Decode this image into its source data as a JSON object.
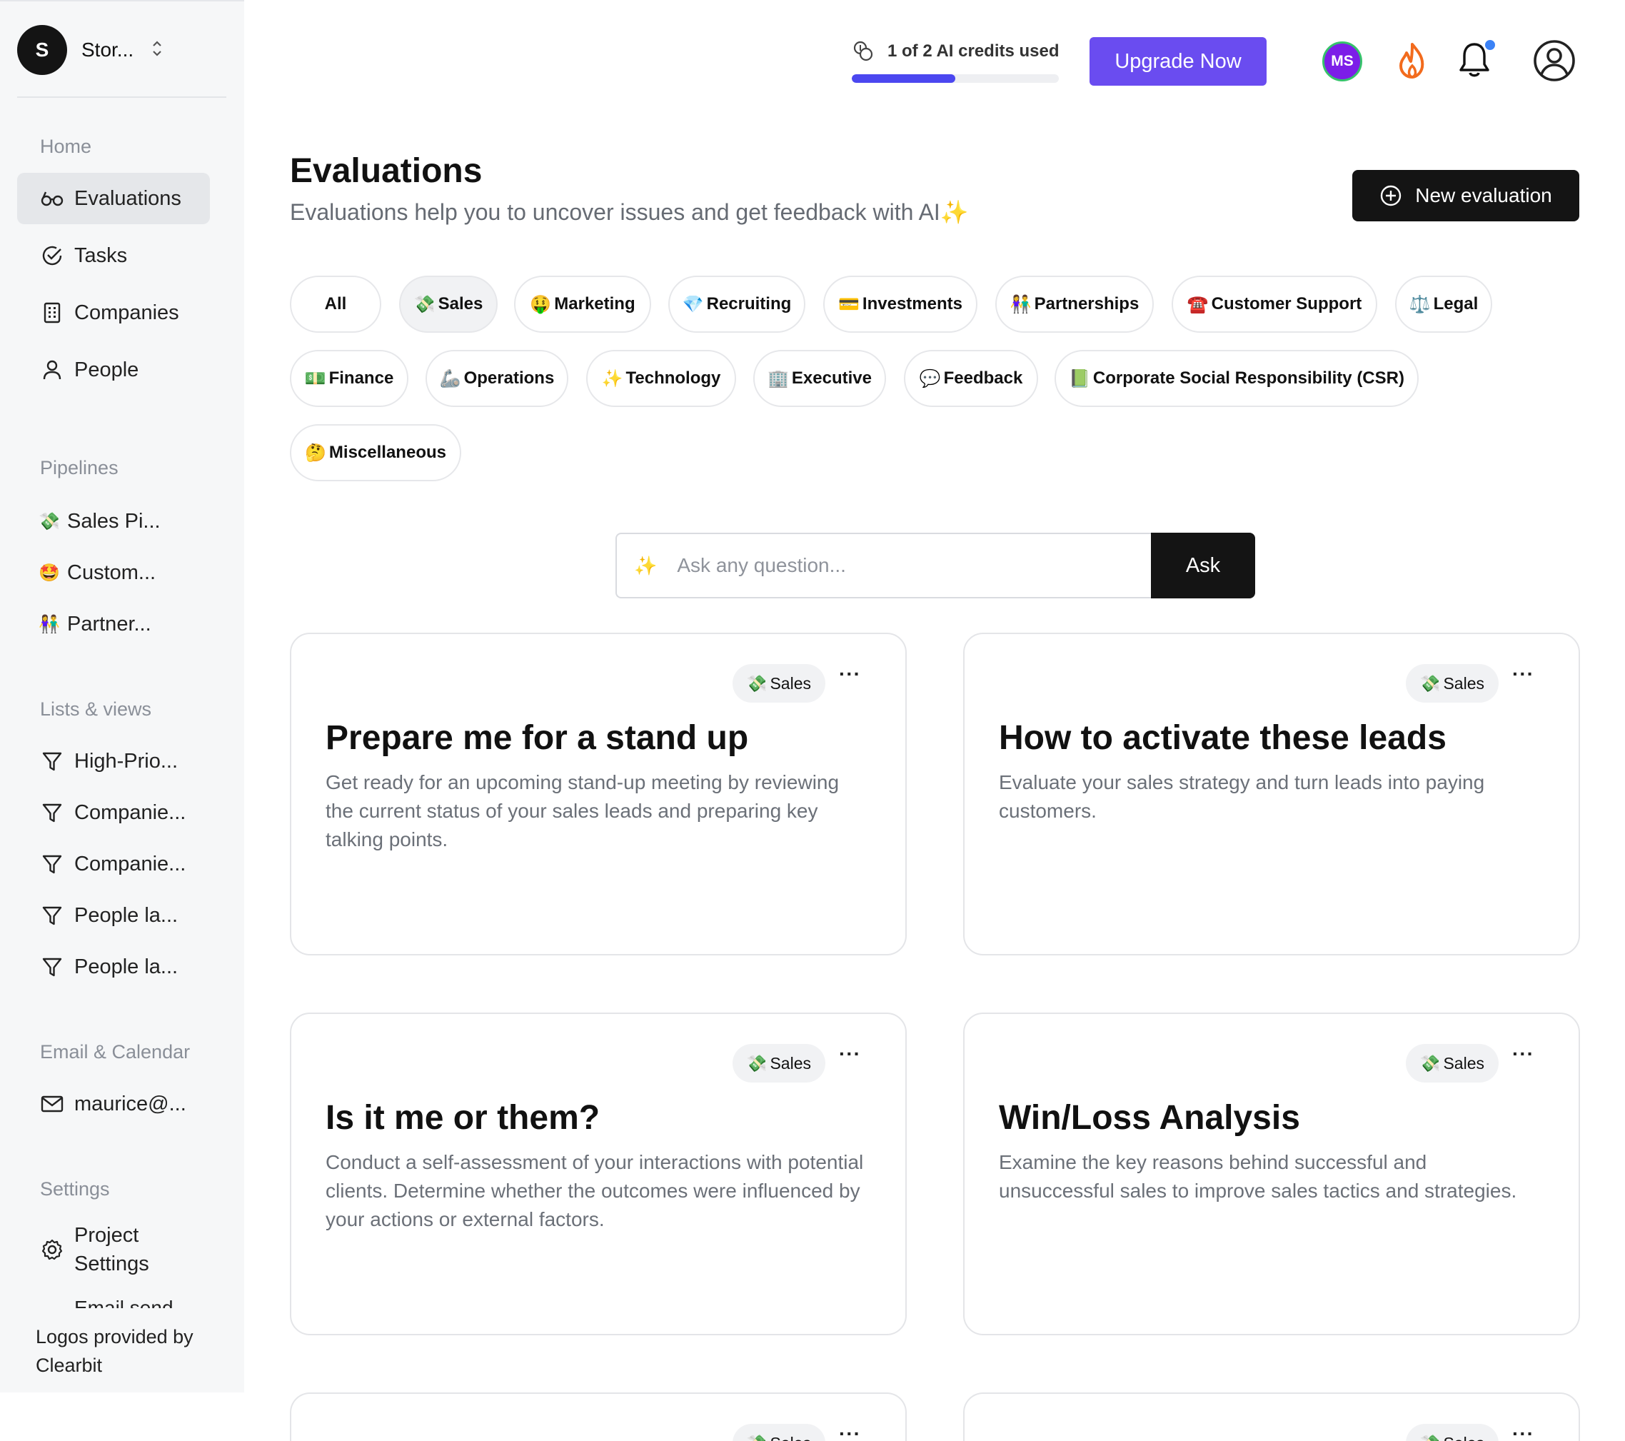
{
  "sidebar": {
    "org": {
      "initial": "S",
      "name": "Stor..."
    },
    "home_title": "Home",
    "nav": [
      {
        "label": "Evaluations",
        "icon": "glasses-icon"
      },
      {
        "label": "Tasks",
        "icon": "check-circle-icon"
      },
      {
        "label": "Companies",
        "icon": "building-icon"
      },
      {
        "label": "People",
        "icon": "person-icon"
      }
    ],
    "pipelines_title": "Pipelines",
    "pipelines": [
      {
        "emoji": "💸",
        "label": "Sales Pi..."
      },
      {
        "emoji": "🤩",
        "label": "Custom..."
      },
      {
        "emoji": "👫",
        "label": "Partner..."
      }
    ],
    "lists_title": "Lists & views",
    "lists": [
      {
        "label": "High-Prio..."
      },
      {
        "label": "Companie..."
      },
      {
        "label": "Companie..."
      },
      {
        "label": "People la..."
      },
      {
        "label": "People la..."
      }
    ],
    "email_title": "Email & Calendar",
    "email": "maurice@...",
    "settings_title": "Settings",
    "settings_item": "Project Settings",
    "settings_clipped": "Email send",
    "footer": "Logos provided by Clearbit"
  },
  "topbar": {
    "credits_text": "1 of 2 AI credits used",
    "credits_progress": 0.5,
    "upgrade_label": "Upgrade Now",
    "avatar_initials": "MS",
    "colors": {
      "upgrade": "#6a4cf0",
      "progress": "#4b47f0",
      "avatar": "#7c1de8",
      "flame": "#f26b1d"
    }
  },
  "header": {
    "title": "Evaluations",
    "subtitle": "Evaluations help you to uncover issues and get feedback with AI✨",
    "new_button": "New evaluation"
  },
  "categories": [
    {
      "emoji": "",
      "label": "All"
    },
    {
      "emoji": "💸",
      "label": "Sales"
    },
    {
      "emoji": "🤑",
      "label": "Marketing"
    },
    {
      "emoji": "💎",
      "label": "Recruiting"
    },
    {
      "emoji": "💳",
      "label": "Investments"
    },
    {
      "emoji": "👫",
      "label": "Partnerships"
    },
    {
      "emoji": "☎️",
      "label": "Customer Support"
    },
    {
      "emoji": "⚖️",
      "label": "Legal"
    },
    {
      "emoji": "💵",
      "label": "Finance"
    },
    {
      "emoji": "🦾",
      "label": "Operations"
    },
    {
      "emoji": "✨",
      "label": "Technology"
    },
    {
      "emoji": "🏢",
      "label": "Executive"
    },
    {
      "emoji": "💬",
      "label": "Feedback"
    },
    {
      "emoji": "📗",
      "label": "Corporate Social Responsibility (CSR)"
    },
    {
      "emoji": "🤔",
      "label": "Miscellaneous"
    }
  ],
  "ask": {
    "placeholder": "Ask any question...",
    "button": "Ask"
  },
  "cards": [
    {
      "tag_emoji": "💸",
      "tag": "Sales",
      "title": "Prepare me for a stand up",
      "description": "Get ready for an upcoming stand-up meeting by reviewing the current status of your sales leads and preparing key talking points."
    },
    {
      "tag_emoji": "💸",
      "tag": "Sales",
      "title": "How to activate these leads",
      "description": "Evaluate your sales strategy and turn leads into paying customers."
    },
    {
      "tag_emoji": "💸",
      "tag": "Sales",
      "title": "Is it me or them?",
      "description": "Conduct a self-assessment of your interactions with potential clients. Determine whether the outcomes were influenced by your actions or external factors."
    },
    {
      "tag_emoji": "💸",
      "tag": "Sales",
      "title": "Win/Loss Analysis",
      "description": "Examine the key reasons behind successful and unsuccessful sales to improve sales tactics and strategies."
    },
    {
      "tag_emoji": "💸",
      "tag": "Sales"
    },
    {
      "tag_emoji": "💸",
      "tag": "Sales"
    }
  ]
}
